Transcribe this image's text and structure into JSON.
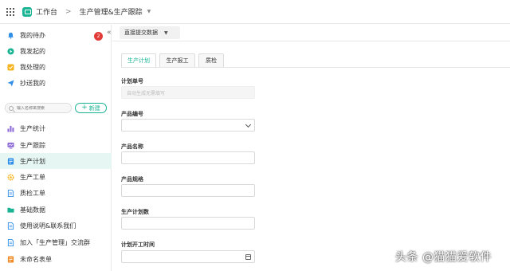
{
  "topbar": {
    "workspace_label": "工作台",
    "breadcrumb_sep": ">",
    "app_title": "生产管理&生产跟踪"
  },
  "sidebar": {
    "collapse_glyph": "«",
    "tasks": [
      {
        "label": "我的待办",
        "icon": "bell-icon",
        "color": "#2f8ee8",
        "badge": "2"
      },
      {
        "label": "我发起的",
        "icon": "play-icon",
        "color": "#1ab394"
      },
      {
        "label": "我处理的",
        "icon": "check-icon",
        "color": "#f6b51e"
      },
      {
        "label": "抄送我的",
        "icon": "send-icon",
        "color": "#2f8ee8"
      }
    ],
    "search_placeholder": "输入名称来搜索",
    "new_button_label": "新建",
    "forms": [
      {
        "label": "生产统计",
        "icon": "chart-icon",
        "color": "#8e6cd8"
      },
      {
        "label": "生产跟踪",
        "icon": "monitor-icon",
        "color": "#8e6cd8"
      },
      {
        "label": "生产计划",
        "icon": "form-icon",
        "color": "#2f8ee8",
        "active": true
      },
      {
        "label": "生产工单",
        "icon": "gear-icon",
        "color": "#f6b51e"
      },
      {
        "label": "质检工单",
        "icon": "doc-icon",
        "color": "#2f8ee8"
      },
      {
        "label": "基础数据",
        "icon": "folder-icon",
        "color": "#1ab394"
      },
      {
        "label": "使用说明&联系我们",
        "icon": "doc-icon",
        "color": "#2f8ee8"
      },
      {
        "label": "加入「生产管理」交流群",
        "icon": "doc-icon",
        "color": "#2f8ee8"
      },
      {
        "label": "未命名表单",
        "icon": "form-icon",
        "color": "#f08a24"
      }
    ]
  },
  "main": {
    "submit_dropdown_label": "直接提交数据",
    "tabs": [
      {
        "label": "生产计划",
        "active": true
      },
      {
        "label": "生产报工"
      },
      {
        "label": "质检"
      }
    ],
    "fields": [
      {
        "label": "计划单号",
        "placeholder": "自动生成无需填写",
        "type": "readonly"
      },
      {
        "label": "产品编号",
        "placeholder": "",
        "type": "select"
      },
      {
        "label": "产品名称",
        "placeholder": "",
        "type": "text"
      },
      {
        "label": "产品规格",
        "placeholder": "",
        "type": "text"
      },
      {
        "label": "生产计划数",
        "placeholder": "",
        "type": "text"
      },
      {
        "label": "计划开工时间",
        "placeholder": "",
        "type": "date"
      }
    ]
  },
  "watermark": "头条 @猫猫爱软件"
}
